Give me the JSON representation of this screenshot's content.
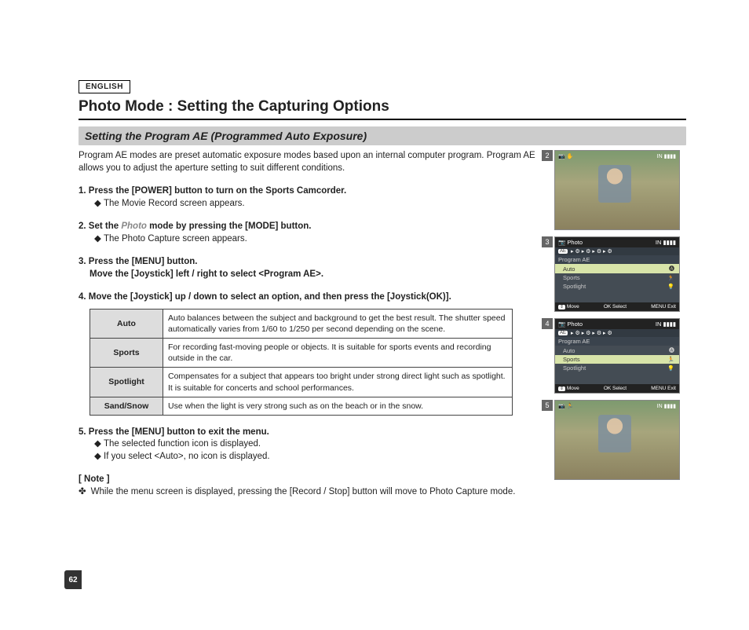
{
  "language_label": "ENGLISH",
  "page_title": "Photo Mode : Setting the Capturing Options",
  "section_heading": "Setting the Program AE (Programmed Auto Exposure)",
  "intro_text": "Program AE modes are preset automatic exposure modes based upon an internal computer program. Program AE allows you to adjust the aperture setting to suit different conditions.",
  "steps": [
    {
      "num": "1.",
      "head": "Press the [POWER] button to turn on the Sports Camcorder.",
      "bullets": [
        "The Movie Record screen appears."
      ]
    },
    {
      "num": "2.",
      "head_pre": "Set the ",
      "head_mode": "Photo",
      "head_post": " mode by pressing the [MODE] button.",
      "bullets": [
        "The Photo Capture screen appears."
      ]
    },
    {
      "num": "3.",
      "head": "Press the [MENU] button.",
      "head2": "Move the [Joystick] left / right to select <Program AE>.",
      "bullets": []
    },
    {
      "num": "4.",
      "head": "Move the [Joystick] up / down to select an option, and then press the [Joystick(OK)].",
      "bullets": []
    },
    {
      "num": "5.",
      "head": "Press the [MENU] button to exit the menu.",
      "bullets": [
        "The selected function icon is displayed.",
        "If you select <Auto>, no icon is displayed."
      ]
    }
  ],
  "options_table": [
    {
      "label": "Auto",
      "desc": "Auto balances between the subject and background to get the best result. The shutter speed automatically varies from 1/60 to 1/250 per second depending on the scene."
    },
    {
      "label": "Sports",
      "desc": "For recording fast-moving people or objects. It is suitable for sports events and recording outside in the car."
    },
    {
      "label": "Spotlight",
      "desc": "Compensates for a subject that appears too bright under strong direct light such as spotlight. It is suitable for concerts and school performances."
    },
    {
      "label": "Sand/Snow",
      "desc": "Use when the light is very strong such as on the beach or in the snow."
    }
  ],
  "note_head": "[ Note ]",
  "note_bullet_mark": "✤",
  "note_text": "While the menu screen is displayed, pressing the [Record / Stop] button will move to Photo Capture mode.",
  "page_number": "62",
  "screens": {
    "s2": {
      "num": "2",
      "top_left": "📷   ✋",
      "top_right": "IN ▮▮▮▮"
    },
    "s3": {
      "num": "3",
      "header_left": "📷 Photo",
      "header_right": "IN ▮▮▮▮",
      "tabs_lead": "AE",
      "title": "Program AE",
      "rows": [
        {
          "label": "Auto",
          "sel": true,
          "icon": "🅐"
        },
        {
          "label": "Sports",
          "sel": false,
          "icon": "🏃"
        },
        {
          "label": "Spotlight",
          "sel": false,
          "icon": "💡"
        }
      ],
      "footer_move": "Move",
      "footer_select": "OK Select",
      "footer_exit": "MENU Exit"
    },
    "s4": {
      "num": "4",
      "header_left": "📷 Photo",
      "header_right": "IN ▮▮▮▮",
      "tabs_lead": "AE",
      "title": "Program AE",
      "rows": [
        {
          "label": "Auto",
          "sel": false,
          "icon": "🅐"
        },
        {
          "label": "Sports",
          "sel": true,
          "icon": "🏃"
        },
        {
          "label": "Spotlight",
          "sel": false,
          "icon": "💡"
        }
      ],
      "footer_move": "Move",
      "footer_select": "OK Select",
      "footer_exit": "MENU Exit"
    },
    "s5": {
      "num": "5",
      "top_left": "📷   🏃",
      "top_right": "IN ▮▮▮▮"
    }
  }
}
